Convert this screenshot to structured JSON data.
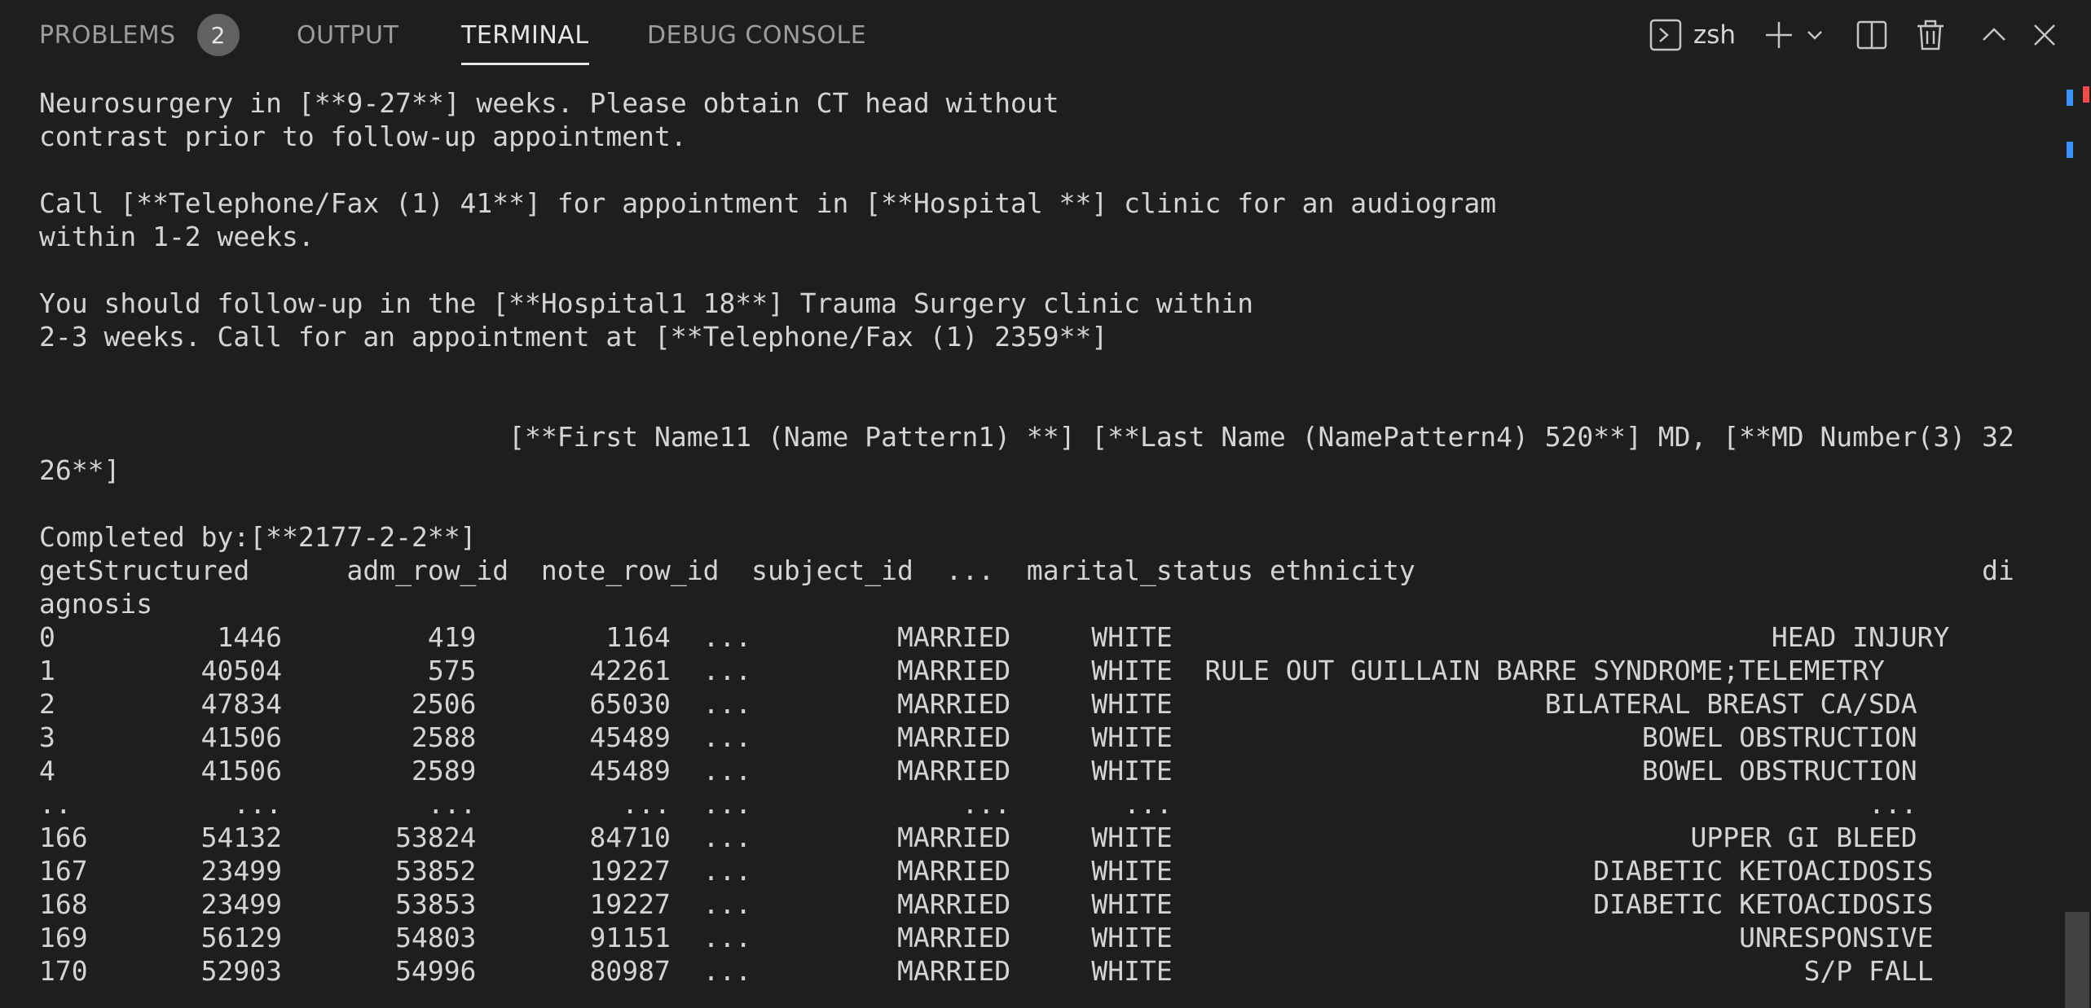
{
  "tabs": [
    {
      "label": "PROBLEMS",
      "badge": "2"
    },
    {
      "label": "OUTPUT"
    },
    {
      "label": "TERMINAL"
    },
    {
      "label": "DEBUG CONSOLE"
    }
  ],
  "active_tab": "TERMINAL",
  "toolbar": {
    "shell_name": "zsh",
    "icons": [
      "terminal-icon",
      "plus-icon",
      "chevron-down-icon",
      "split-terminal-icon",
      "trash-icon",
      "maximize-icon",
      "close-icon"
    ]
  },
  "terminal": {
    "lines": [
      "Neurosurgery in [**9-27**] weeks. Please obtain CT head without",
      "contrast prior to follow-up appointment.",
      "",
      "Call [**Telephone/Fax (1) 41**] for appointment in [**Hospital **] clinic for an audiogram",
      "within 1-2 weeks.",
      "",
      "You should follow-up in the [**Hospital1 18**] Trauma Surgery clinic within",
      "2-3 weeks. Call for an appointment at [**Telephone/Fax (1) 2359**]",
      "",
      "",
      "                             [**First Name11 (Name Pattern1) **] [**Last Name (NamePattern4) 520**] MD, [**MD Number(3) 32",
      "26**]",
      "",
      "Completed by:[**2177-2-2**]",
      "getStructured      adm_row_id  note_row_id  subject_id  ...  marital_status ethnicity                                   di",
      "agnosis",
      "0          1446         419        1164  ...         MARRIED     WHITE                                     HEAD INJURY",
      "1         40504         575       42261  ...         MARRIED     WHITE  RULE OUT GUILLAIN BARRE SYNDROME;TELEMETRY",
      "2         47834        2506       65030  ...         MARRIED     WHITE                       BILATERAL BREAST CA/SDA",
      "3         41506        2588       45489  ...         MARRIED     WHITE                             BOWEL OBSTRUCTION",
      "4         41506        2589       45489  ...         MARRIED     WHITE                             BOWEL OBSTRUCTION",
      "..          ...         ...         ...  ...             ...       ...                                           ...",
      "166       54132       53824       84710  ...         MARRIED     WHITE                                UPPER GI BLEED",
      "167       23499       53852       19227  ...         MARRIED     WHITE                          DIABETIC KETOACIDOSIS",
      "168       23499       53853       19227  ...         MARRIED     WHITE                          DIABETIC KETOACIDOSIS",
      "169       56129       54803       91151  ...         MARRIED     WHITE                                   UNRESPONSIVE",
      "170       52903       54996       80987  ...         MARRIED     WHITE                                       S/P FALL"
    ]
  },
  "colors": {
    "background": "#1e1e1e",
    "text": "#d4d4d4",
    "tab_inactive": "#9d9d9d",
    "tab_active": "#e7e7e7",
    "badge": "#616161",
    "scroll_marker_red": "#f14c4c",
    "scroll_marker_blue": "#3794ff"
  }
}
